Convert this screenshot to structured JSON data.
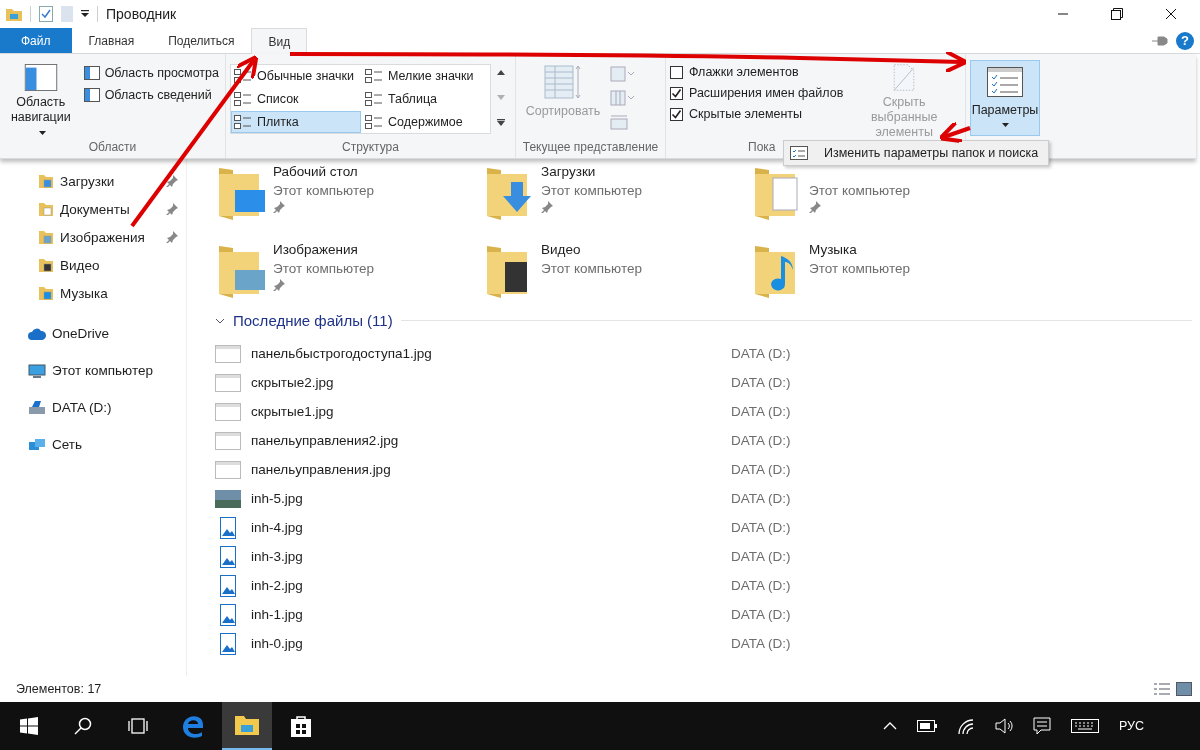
{
  "window": {
    "title": "Проводник"
  },
  "tabs": [
    {
      "label": "Файл",
      "kind": "file",
      "selected": false
    },
    {
      "label": "Главная",
      "kind": "tab",
      "selected": false
    },
    {
      "label": "Поделиться",
      "kind": "tab",
      "selected": false
    },
    {
      "label": "Вид",
      "kind": "tab",
      "selected": true
    }
  ],
  "help_label": "?",
  "ribbon": {
    "panes": {
      "label": "Области",
      "nav_button": "Область навигации",
      "items": [
        "Область просмотра",
        "Область сведений"
      ]
    },
    "layout": {
      "label": "Структура",
      "options": [
        {
          "label": "Обычные значки",
          "selected": false
        },
        {
          "label": "Мелкие значки",
          "selected": false
        },
        {
          "label": "Список",
          "selected": false
        },
        {
          "label": "Таблица",
          "selected": false
        },
        {
          "label": "Плитка",
          "selected": true
        },
        {
          "label": "Содержимое",
          "selected": false
        }
      ]
    },
    "current_view": {
      "label": "Текущее представление",
      "sort_button": "Сортировать",
      "disabled": true
    },
    "show_hide": {
      "label": "Пока",
      "checkboxes": [
        {
          "label": "Флажки элементов",
          "checked": false
        },
        {
          "label": "Расширения имен файлов",
          "checked": true
        },
        {
          "label": "Скрытые элементы",
          "checked": true
        }
      ],
      "hide_button": "Скрыть выбранные элементы",
      "hide_disabled": true
    },
    "options": {
      "label": "Параметры",
      "pressed": true
    }
  },
  "options_menu": {
    "items": [
      "Изменить параметры папок и поиска"
    ]
  },
  "sidebar": {
    "quick_access": [
      {
        "label": "Загрузки",
        "kind": "downloads",
        "pinned": true
      },
      {
        "label": "Документы",
        "kind": "documents",
        "pinned": true
      },
      {
        "label": "Изображения",
        "kind": "pictures",
        "pinned": true
      },
      {
        "label": "Видео",
        "kind": "video",
        "pinned": false
      },
      {
        "label": "Музыка",
        "kind": "music",
        "pinned": false
      }
    ],
    "locations": [
      {
        "label": "OneDrive",
        "kind": "cloud"
      },
      {
        "label": "Этот компьютер",
        "kind": "pc"
      },
      {
        "label": "DATA (D:)",
        "kind": "drive"
      },
      {
        "label": "Сеть",
        "kind": "network"
      }
    ]
  },
  "folders": [
    {
      "name": "Рабочий стол",
      "location": "Этот компьютер",
      "kind": "desktop",
      "pinned": true
    },
    {
      "name": "Загрузки",
      "location": "Этот компьютер",
      "kind": "downloads",
      "pinned": true
    },
    {
      "location": "Этот компьютер",
      "kind": "documents",
      "pinned": true
    },
    {
      "name": "Изображения",
      "location": "Этот компьютер",
      "kind": "pictures",
      "pinned": true
    },
    {
      "name": "Видео",
      "location": "Этот компьютер",
      "kind": "video",
      "pinned": false
    },
    {
      "name": "Музыка",
      "location": "Этот компьютер",
      "kind": "music",
      "pinned": false
    }
  ],
  "recent": {
    "title": "Последние файлы (11)",
    "expanded": true,
    "files": [
      {
        "name": "панельбыстрогодоступа1.jpg",
        "location": "DATA (D:)",
        "kind": "screenshot"
      },
      {
        "name": "скрытые2.jpg",
        "location": "DATA (D:)",
        "kind": "screenshot"
      },
      {
        "name": "скрытые1.jpg",
        "location": "DATA (D:)",
        "kind": "screenshot"
      },
      {
        "name": "панельуправления2.jpg",
        "location": "DATA (D:)",
        "kind": "screenshot"
      },
      {
        "name": "панельуправления.jpg",
        "location": "DATA (D:)",
        "kind": "screenshot"
      },
      {
        "name": "inh-5.jpg",
        "location": "DATA (D:)",
        "kind": "photo"
      },
      {
        "name": "inh-4.jpg",
        "location": "DATA (D:)",
        "kind": "image"
      },
      {
        "name": "inh-3.jpg",
        "location": "DATA (D:)",
        "kind": "image"
      },
      {
        "name": "inh-2.jpg",
        "location": "DATA (D:)",
        "kind": "image"
      },
      {
        "name": "inh-1.jpg",
        "location": "DATA (D:)",
        "kind": "image"
      },
      {
        "name": "inh-0.jpg",
        "location": "DATA (D:)",
        "kind": "image"
      }
    ]
  },
  "status_bar": {
    "count": "Элементов: 17"
  },
  "taskbar": {
    "apps": [
      {
        "kind": "edge",
        "active": false
      },
      {
        "kind": "explorer",
        "active": true
      },
      {
        "kind": "store",
        "active": false
      }
    ],
    "language": "РУС"
  }
}
